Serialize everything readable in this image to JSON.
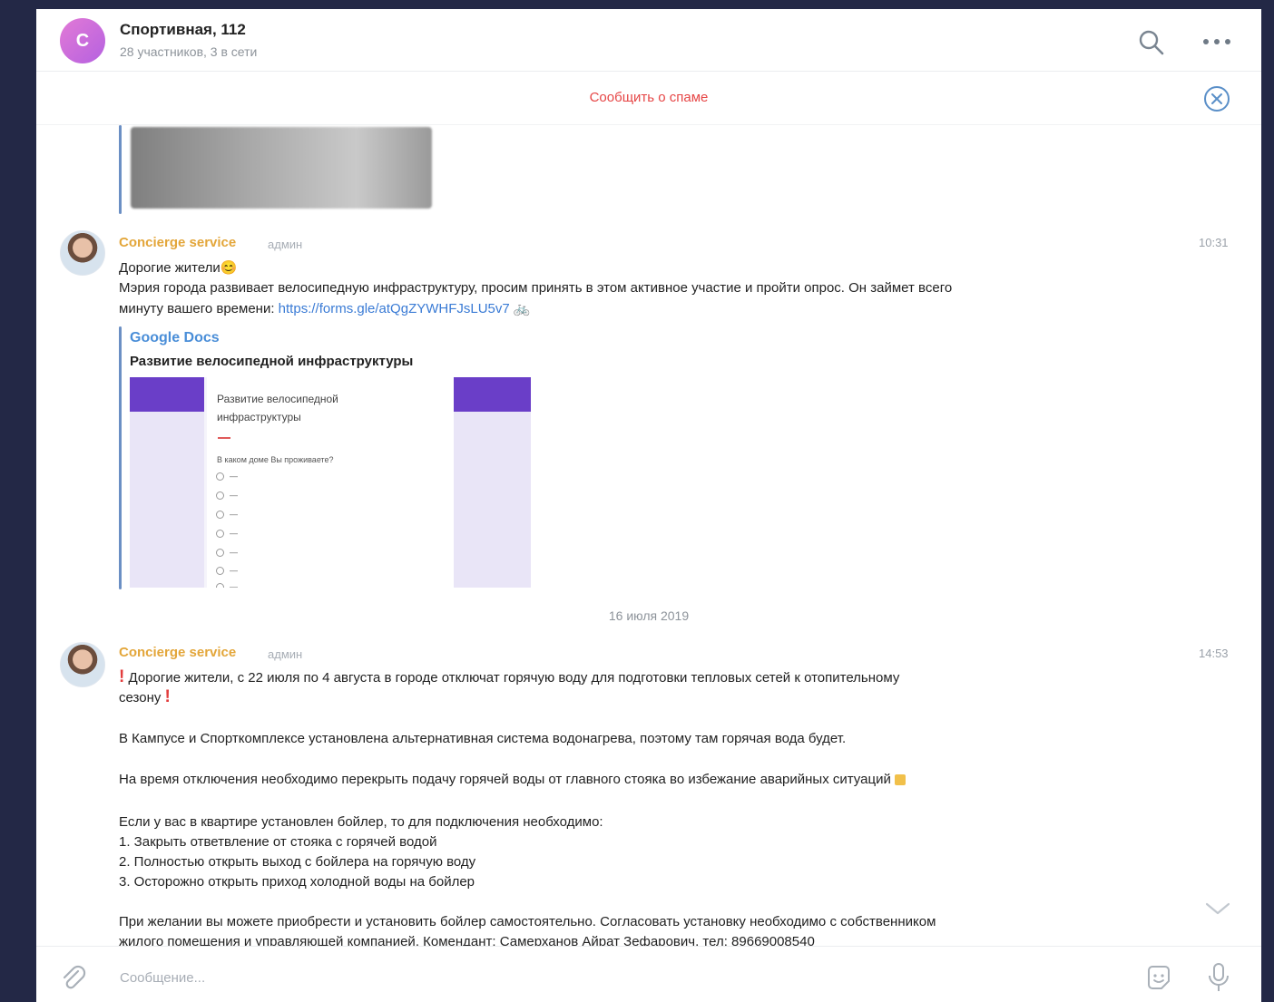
{
  "header": {
    "avatar_letter": "С",
    "title": "Спортивная, 112",
    "subtitle": "28 участников, 3 в сети"
  },
  "spam_bar": {
    "label": "Сообщить о спаме"
  },
  "messages": [
    {
      "sender": "Concierge service",
      "role": "админ",
      "time": "10:31",
      "greeting": "Дорогие жители😊",
      "body_line1": "Мэрия города развивает велосипедную инфраструктуру, просим принять в этом активное участие и пройти опрос. Он займет всего",
      "body_line2_prefix": "минуту вашего времени: ",
      "link": "https://forms.gle/atQgZYWHFJsLU5v7",
      "bike": "🚲",
      "snippet": {
        "site": "Google Docs",
        "title": "Развитие велосипедной инфраструктуры",
        "preview_title_line1": "Развитие велосипедной",
        "preview_title_line2": "инфраструктуры",
        "preview_question": "В каком доме Вы проживаете?",
        "options": [
          "—",
          "—",
          "—",
          "—",
          "—",
          "—",
          "—"
        ]
      }
    },
    {
      "sender": "Concierge service",
      "role": "админ",
      "time": "14:53",
      "line1": " Дорогие жители, с 22 июля по 4 августа в городе отключат горячую воду для подготовки тепловых сетей к отопительному",
      "line2": "сезону ",
      "line3": "В Кампусе и Спорткомплексе установлена альтернативная система водонагрева, поэтому там горячая вода будет.",
      "line4": "На время отключения необходимо перекрыть подачу горячей воды от главного стояка во избежание аварийных ситуаций ",
      "line5": "Если у вас в квартире установлен бойлер, то для подключения необходимо:",
      "line6": "1. Закрыть ответвление от стояка с горячей водой",
      "line7": "2. Полностью открыть выход с бойлера на горячую воду",
      "line8": "3. Осторожно открыть приход холодной воды на бойлер",
      "line9": "При желании вы можете приобрести и установить бойлер самостоятельно. Согласовать установку необходимо с собственником",
      "line10": "жилого помещения и управляющей компанией. Комендант: Самерханов Айрат Зефарович, тел: 89669008540"
    }
  ],
  "date_separator": "16 июля 2019",
  "composer": {
    "placeholder": "Сообщение..."
  },
  "colors": {
    "accent": "#4a8ed8",
    "sender": "#e3a63a",
    "spam": "#e64646",
    "background": "#232846"
  },
  "icons": [
    "search-icon",
    "more-icon",
    "close-icon",
    "chevron-down-icon",
    "attach-icon",
    "sticker-icon",
    "mic-icon"
  ]
}
